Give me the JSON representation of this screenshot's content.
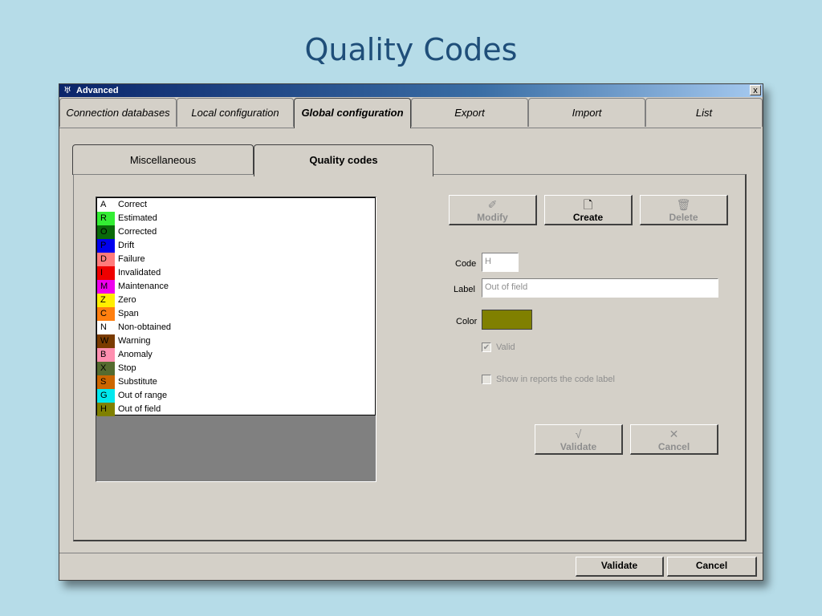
{
  "slide": {
    "title": "Quality Codes"
  },
  "window": {
    "title": "Advanced",
    "icon": "app-logo-icon",
    "close_label": "x"
  },
  "top_tabs": [
    {
      "label": "Connection databases",
      "active": false
    },
    {
      "label": "Local configuration",
      "active": false
    },
    {
      "label": "Global configuration",
      "active": true
    },
    {
      "label": "Export",
      "active": false
    },
    {
      "label": "Import",
      "active": false
    },
    {
      "label": "List",
      "active": false
    }
  ],
  "inner_tabs": [
    {
      "label": "Miscellaneous",
      "active": false
    },
    {
      "label": "Quality codes",
      "active": true
    }
  ],
  "quality_codes": [
    {
      "code": "A",
      "label": "Correct",
      "color": "#ffffff"
    },
    {
      "code": "R",
      "label": "Estimated",
      "color": "#33ee33"
    },
    {
      "code": "O",
      "label": "Corrected",
      "color": "#0a6a0a"
    },
    {
      "code": "P",
      "label": "Drift",
      "color": "#0000ee"
    },
    {
      "code": "D",
      "label": "Failure",
      "color": "#ff7b7b"
    },
    {
      "code": "I",
      "label": "Invalidated",
      "color": "#ee0000"
    },
    {
      "code": "M",
      "label": "Maintenance",
      "color": "#ee00ee"
    },
    {
      "code": "Z",
      "label": "Zero",
      "color": "#ffee00"
    },
    {
      "code": "C",
      "label": "Span",
      "color": "#ff7f0f"
    },
    {
      "code": "N",
      "label": "Non-obtained",
      "color": "#ffffff"
    },
    {
      "code": "W",
      "label": "Warning",
      "color": "#7a3b00"
    },
    {
      "code": "B",
      "label": "Anomaly",
      "color": "#ff8fb0"
    },
    {
      "code": "X",
      "label": "Stop",
      "color": "#556b2f"
    },
    {
      "code": "S",
      "label": "Substitute",
      "color": "#cc6600"
    },
    {
      "code": "G",
      "label": "Out of range",
      "color": "#00e8ee"
    },
    {
      "code": "H",
      "label": "Out of field",
      "color": "#808000"
    }
  ],
  "actions": {
    "modify": {
      "label": "Modify",
      "icon": "pencil-icon"
    },
    "create": {
      "label": "Create",
      "icon": "new-document-icon"
    },
    "delete": {
      "label": "Delete",
      "icon": "trash-icon"
    }
  },
  "form": {
    "code_label": "Code",
    "code_value": "H",
    "label_label": "Label",
    "label_value": "Out of field",
    "color_label": "Color",
    "color_value": "#808000",
    "valid_label": "Valid",
    "valid_checked": true,
    "show_label": "Show in reports the code label",
    "show_checked": false
  },
  "form_actions": {
    "validate": {
      "label": "Validate",
      "icon": "checkmark-icon"
    },
    "cancel": {
      "label": "Cancel",
      "icon": "x-mark-icon"
    }
  },
  "footer": {
    "validate_label": "Validate",
    "cancel_label": "Cancel"
  }
}
